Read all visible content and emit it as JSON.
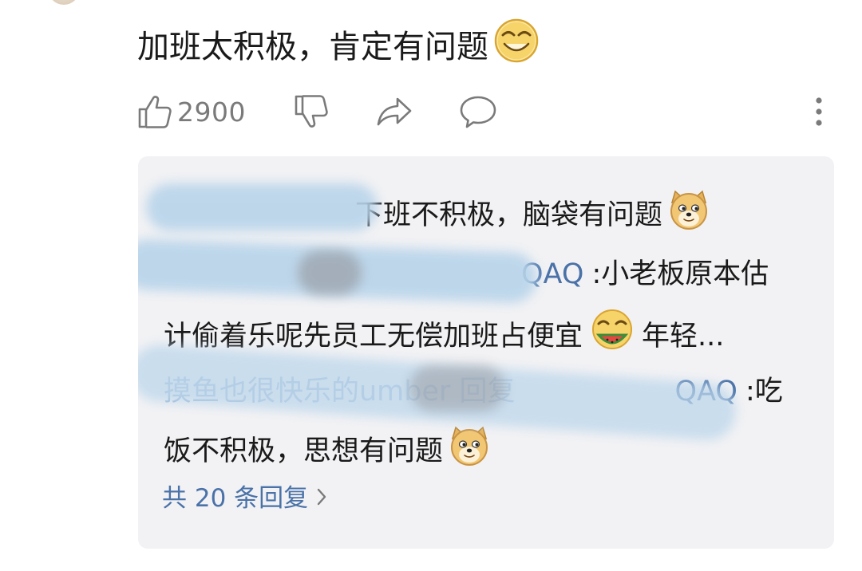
{
  "comment": {
    "text": "加班太积极，肯定有问题",
    "emoji": "laughing-squint-emoji"
  },
  "actions": {
    "like_count": "2900",
    "icons": [
      "thumbs-up-icon",
      "thumbs-down-icon",
      "share-icon",
      "comment-icon",
      "more-vertical-icon"
    ]
  },
  "replies": [
    {
      "name": "",
      "text": "下班不积极，脑袋有问题",
      "emoji": "doge-emoji"
    },
    {
      "name": "QAQ",
      "text_line1": ":小老板原本估",
      "text_line2": "计偷着乐呢先员工无偿加班占便宜",
      "emoji": "laughing-watermelon-emoji",
      "text_tail": "年轻..."
    },
    {
      "name_prefix": "摸鱼也很快乐的umber 回复",
      "name": "QAQ",
      "text_line1": ":吃",
      "text_line2": "饭不积极，思想有问题",
      "emoji": "doge-emoji"
    }
  ],
  "more_replies": {
    "label": "共 20 条回复"
  },
  "colors": {
    "link": "#4a72a8",
    "panel_bg": "#f2f2f4",
    "icon_gray": "#7a7a7a"
  }
}
